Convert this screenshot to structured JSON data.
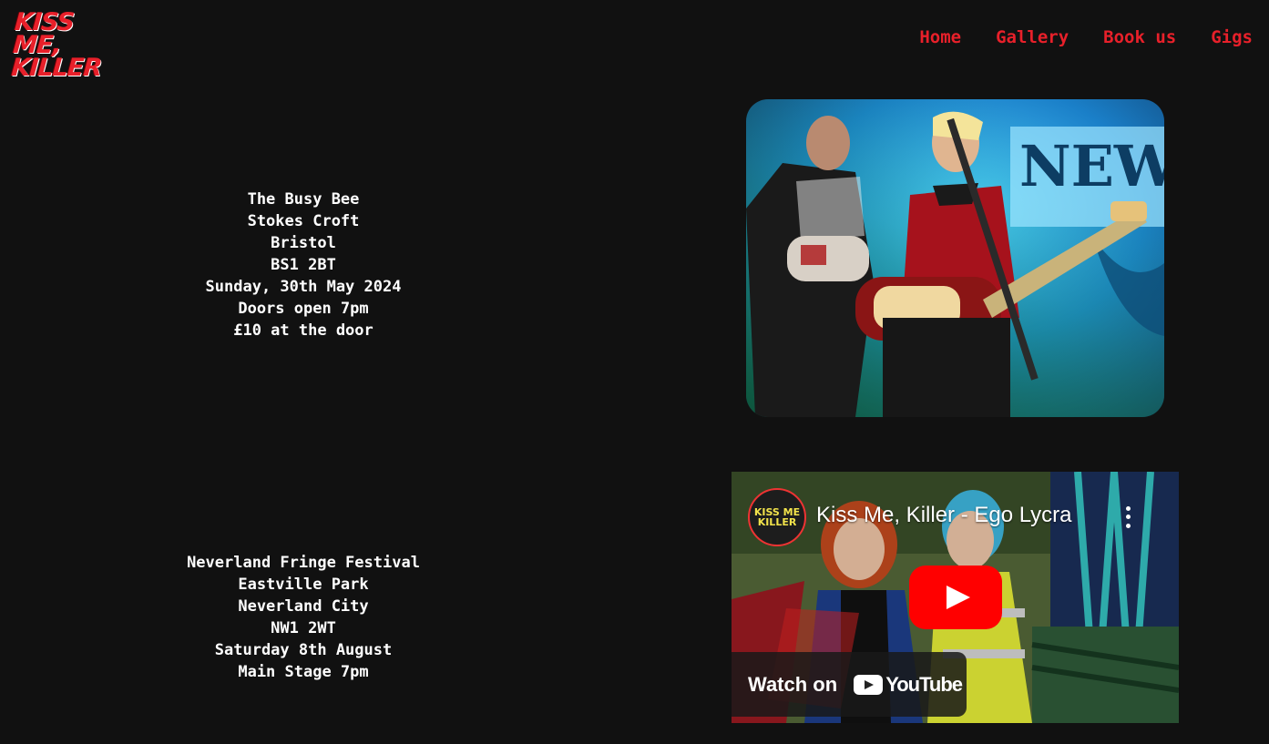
{
  "header": {
    "logo_line1": "KISS ME,",
    "logo_line2": "KILLER",
    "nav": [
      "Home",
      "Gallery",
      "Book us",
      "Gigs"
    ]
  },
  "gigs": [
    {
      "venue": "The Busy Bee",
      "area": "Stokes Croft",
      "city": "Bristol",
      "postcode": "BS1 2BT",
      "date": "Sunday, 30th May 2024",
      "doors": "Doors open 7pm",
      "price": "£10 at the door"
    },
    {
      "venue": "Neverland Fringe Festival",
      "area": "Eastville Park",
      "city": "Neverland City",
      "postcode": "NW1 2WT",
      "date": "Saturday 8th August",
      "doors": "Main Stage 7pm"
    }
  ],
  "photo": {
    "backdrop_text": "NEW"
  },
  "video": {
    "channel_avatar_text": "KISS ME KILLER",
    "title": "Kiss Me, Killer - Ego Lycra",
    "watch_label": "Watch on",
    "youtube_text": "YouTube"
  },
  "colors": {
    "accent": "#e8202a",
    "background": "#111111",
    "text": "#ffffff"
  }
}
